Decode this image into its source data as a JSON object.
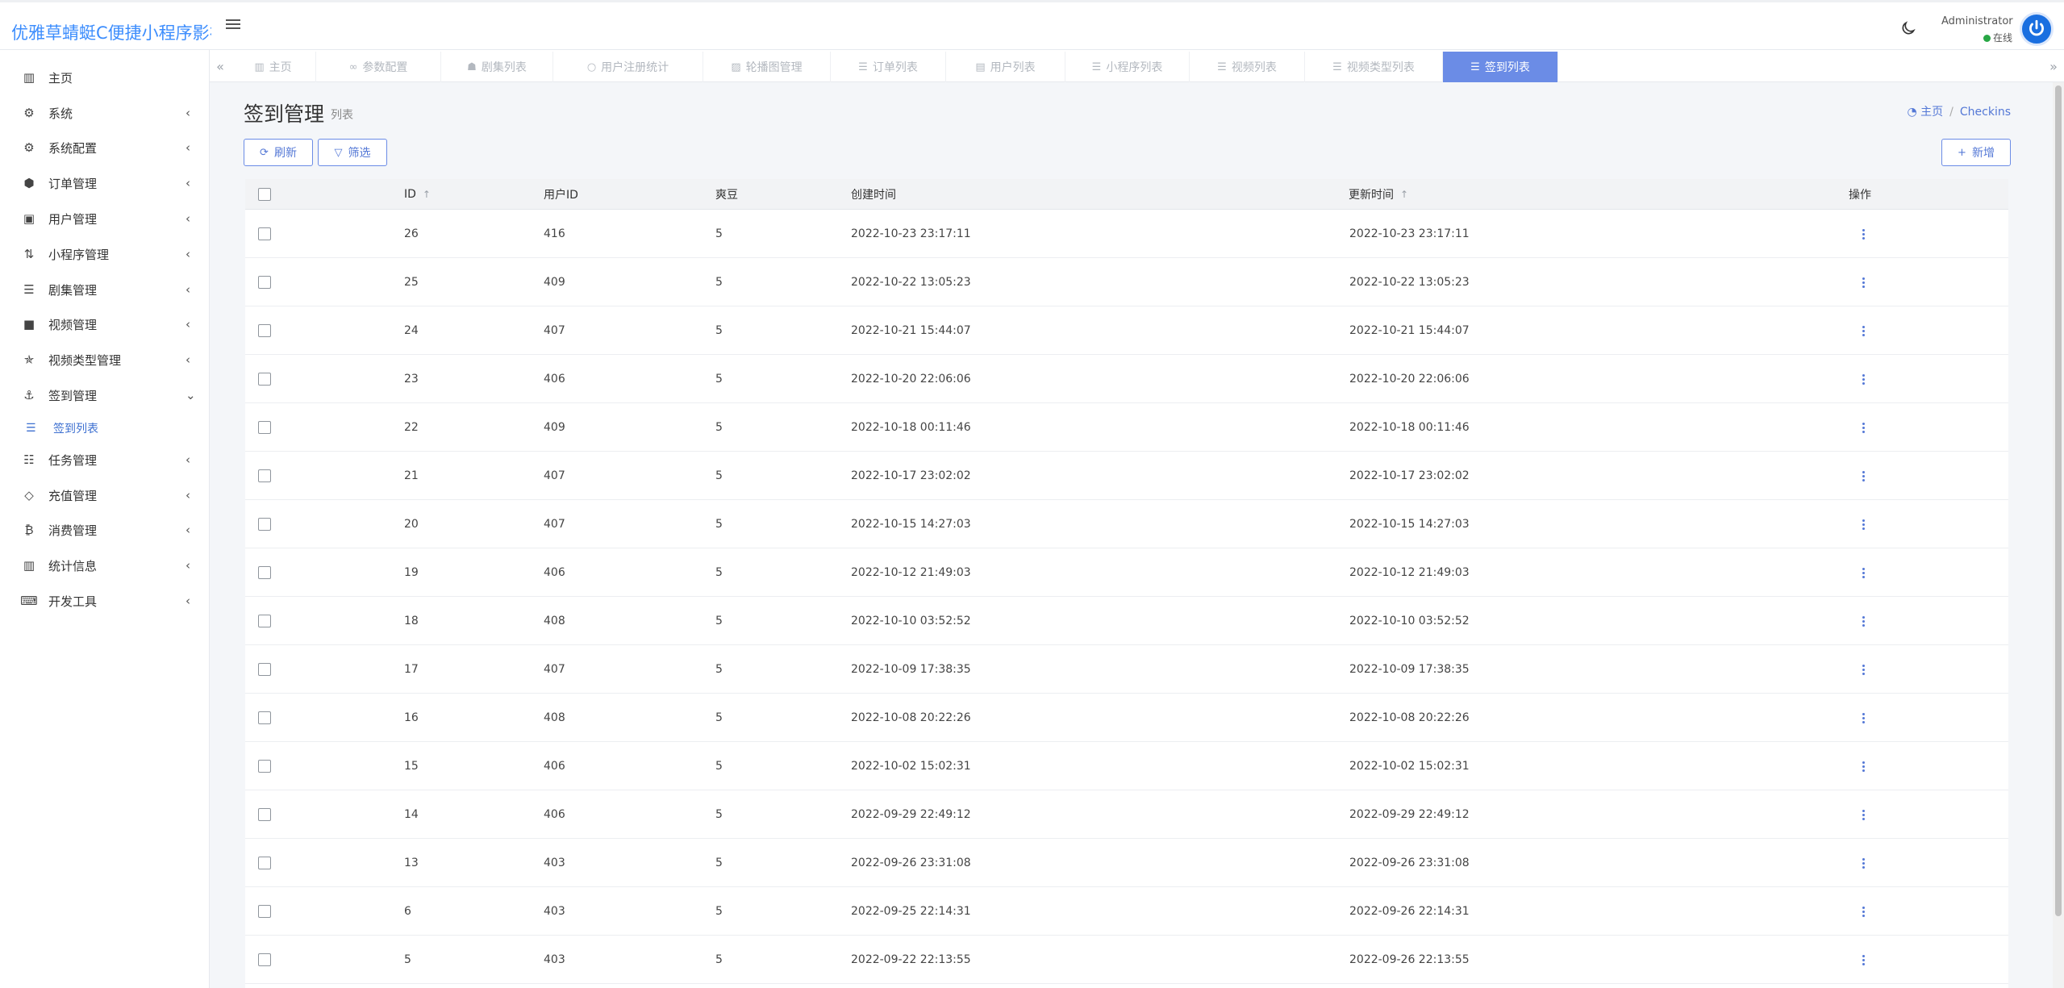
{
  "app": {
    "brand": "优雅草蜻蜓C便捷小程序影视"
  },
  "user": {
    "name": "Administrator",
    "status": "在线"
  },
  "sidebar": {
    "items": [
      {
        "label": "主页",
        "icon": "bar-chart-icon",
        "arrow": false
      },
      {
        "label": "系统",
        "icon": "gear-icon",
        "arrow": true
      },
      {
        "label": "系统配置",
        "icon": "gears-icon",
        "arrow": true
      },
      {
        "label": "订单管理",
        "icon": "hexagon-icon",
        "arrow": true
      },
      {
        "label": "用户管理",
        "icon": "address-book-icon",
        "arrow": true
      },
      {
        "label": "小程序管理",
        "icon": "sort-amount-icon",
        "arrow": true
      },
      {
        "label": "剧集管理",
        "icon": "list-icon",
        "arrow": true
      },
      {
        "label": "视频管理",
        "icon": "video-camera-icon",
        "arrow": true
      },
      {
        "label": "视频类型管理",
        "icon": "star-half-icon",
        "arrow": true
      },
      {
        "label": "签到管理",
        "icon": "anchor-icon",
        "arrow": "down"
      },
      {
        "label": "签到列表",
        "icon": "list-icon",
        "sub": true
      },
      {
        "label": "任务管理",
        "icon": "tasks-icon",
        "arrow": true
      },
      {
        "label": "充值管理",
        "icon": "diamond-icon",
        "arrow": true
      },
      {
        "label": "消费管理",
        "icon": "bitcoin-icon",
        "arrow": true
      },
      {
        "label": "统计信息",
        "icon": "bar-chart-icon",
        "arrow": true
      },
      {
        "label": "开发工具",
        "icon": "keyboard-icon",
        "arrow": true
      }
    ]
  },
  "tabs": [
    {
      "label": "主页",
      "icon": "bar-chart-icon"
    },
    {
      "label": "参数配置",
      "icon": "link-icon"
    },
    {
      "label": "剧集列表",
      "icon": "user-group-icon"
    },
    {
      "label": "用户注册统计",
      "icon": "circle-icon"
    },
    {
      "label": "轮播图管理",
      "icon": "image-icon"
    },
    {
      "label": "订单列表",
      "icon": "list-icon"
    },
    {
      "label": "用户列表",
      "icon": "address-card-icon"
    },
    {
      "label": "小程序列表",
      "icon": "list-icon"
    },
    {
      "label": "视频列表",
      "icon": "list-icon"
    },
    {
      "label": "视频类型列表",
      "icon": "list-icon"
    },
    {
      "label": "签到列表",
      "icon": "list-icon",
      "active": true
    }
  ],
  "page": {
    "title": "签到管理",
    "subtitle": "列表",
    "breadcrumb_home": "主页",
    "breadcrumb_current": "Checkins"
  },
  "toolbar": {
    "refresh_label": "刷新",
    "filter_label": "筛选",
    "new_label": "新增"
  },
  "table": {
    "columns": [
      "ID",
      "用户ID",
      "爽豆",
      "创建时间",
      "更新时间",
      "操作"
    ],
    "rows": [
      [
        "26",
        "416",
        "5",
        "2022-10-23 23:17:11",
        "2022-10-23 23:17:11"
      ],
      [
        "25",
        "409",
        "5",
        "2022-10-22 13:05:23",
        "2022-10-22 13:05:23"
      ],
      [
        "24",
        "407",
        "5",
        "2022-10-21 15:44:07",
        "2022-10-21 15:44:07"
      ],
      [
        "23",
        "406",
        "5",
        "2022-10-20 22:06:06",
        "2022-10-20 22:06:06"
      ],
      [
        "22",
        "409",
        "5",
        "2022-10-18 00:11:46",
        "2022-10-18 00:11:46"
      ],
      [
        "21",
        "407",
        "5",
        "2022-10-17 23:02:02",
        "2022-10-17 23:02:02"
      ],
      [
        "20",
        "407",
        "5",
        "2022-10-15 14:27:03",
        "2022-10-15 14:27:03"
      ],
      [
        "19",
        "406",
        "5",
        "2022-10-12 21:49:03",
        "2022-10-12 21:49:03"
      ],
      [
        "18",
        "408",
        "5",
        "2022-10-10 03:52:52",
        "2022-10-10 03:52:52"
      ],
      [
        "17",
        "407",
        "5",
        "2022-10-09 17:38:35",
        "2022-10-09 17:38:35"
      ],
      [
        "16",
        "408",
        "5",
        "2022-10-08 20:22:26",
        "2022-10-08 20:22:26"
      ],
      [
        "15",
        "406",
        "5",
        "2022-10-02 15:02:31",
        "2022-10-02 15:02:31"
      ],
      [
        "14",
        "406",
        "5",
        "2022-09-29 22:49:12",
        "2022-09-29 22:49:12"
      ],
      [
        "13",
        "403",
        "5",
        "2022-09-26 23:31:08",
        "2022-09-26 23:31:08"
      ],
      [
        "6",
        "403",
        "5",
        "2022-09-25 22:14:31",
        "2022-09-26 22:14:31"
      ],
      [
        "5",
        "403",
        "5",
        "2022-09-22 22:13:55",
        "2022-09-26 22:13:55"
      ]
    ]
  },
  "colors": {
    "brand": "#3c8dfd",
    "accent": "#6b8ce6",
    "online": "#28a745"
  }
}
